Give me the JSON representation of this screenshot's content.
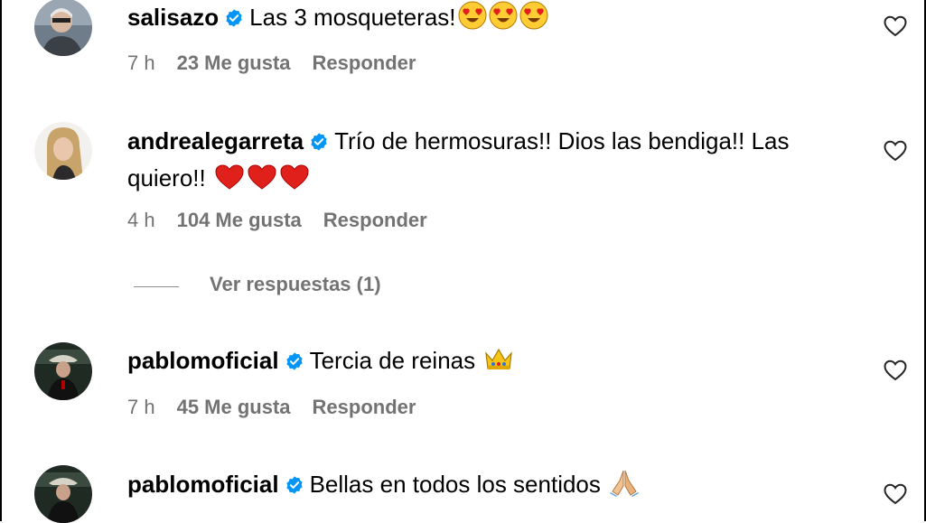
{
  "comments": [
    {
      "username": "salisazo",
      "text": "Las 3 mosqueteras!",
      "emojis": [
        "heart-eyes",
        "heart-eyes",
        "heart-eyes"
      ],
      "time": "7 h",
      "likes": "23 Me gusta",
      "reply": "Responder"
    },
    {
      "username": "andrealegarreta",
      "text": "Trío de hermosuras!! Dios las bendiga!! Las quiero!!",
      "emojis": [
        "red-heart",
        "red-heart",
        "red-heart"
      ],
      "time": "4 h",
      "likes": "104 Me gusta",
      "reply": "Responder"
    },
    {
      "username": "pablomoficial",
      "text": "Tercia de reinas",
      "emojis": [
        "crown"
      ],
      "time": "7 h",
      "likes": "45 Me gusta",
      "reply": "Responder"
    },
    {
      "username": "pablomoficial",
      "text": "Bellas en todos los sentidos",
      "emojis": [
        "folded-hands"
      ]
    }
  ],
  "view_replies": "Ver respuestas (1)",
  "colors": {
    "verified": "#0095f6",
    "meta_text": "#737373",
    "heart_emoji": "#e0211b"
  }
}
